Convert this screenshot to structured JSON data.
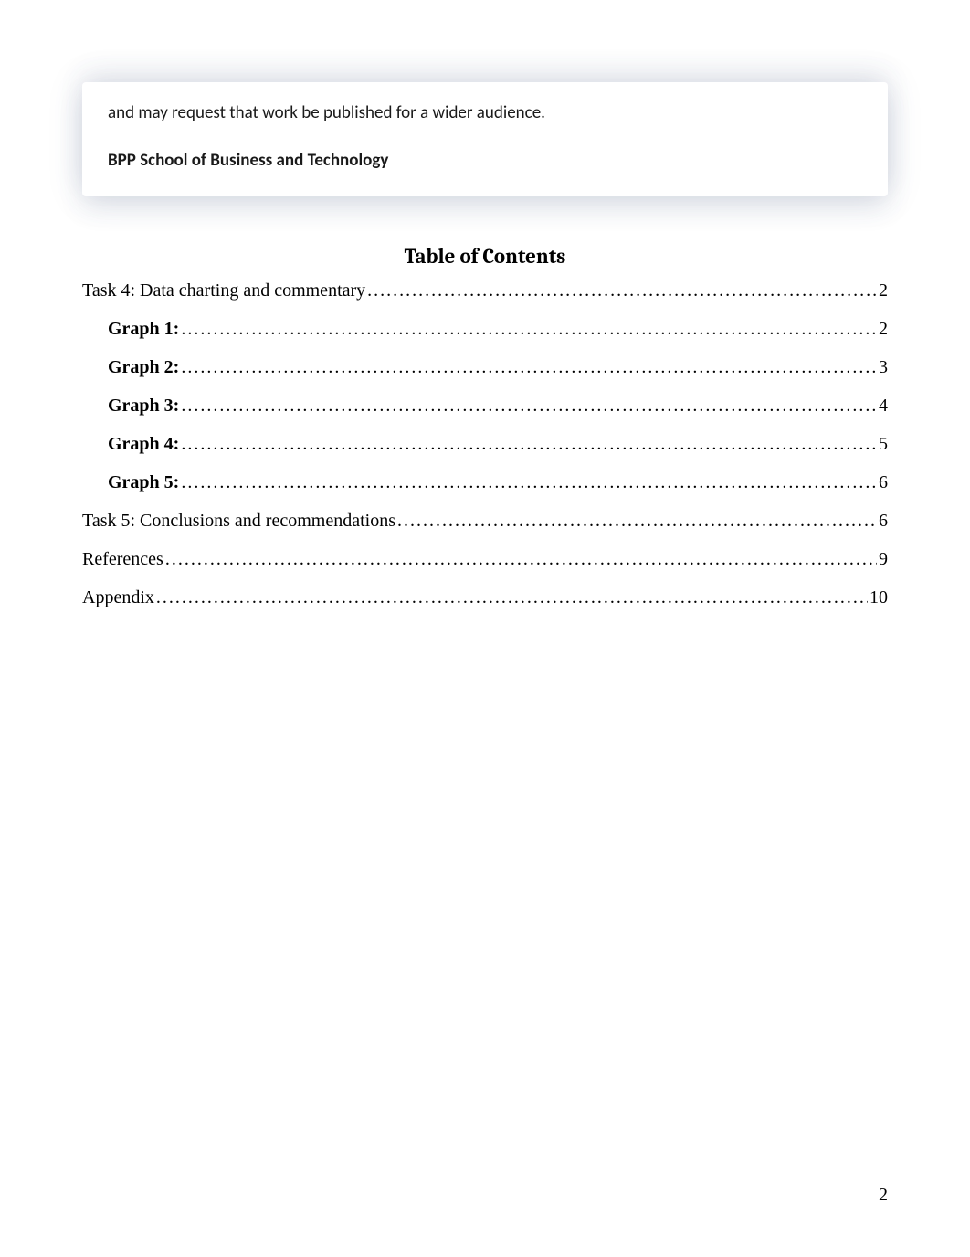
{
  "info_box": {
    "line": "and may request that work be published for a wider audience.",
    "school": "BPP School of Business and Technology"
  },
  "toc": {
    "heading": "Table of Contents",
    "entries": [
      {
        "label": "Task 4: Data charting and commentary",
        "page": "2",
        "level": 1,
        "bold": false
      },
      {
        "label": "Graph 1:",
        "page": "2",
        "level": 2,
        "bold": true
      },
      {
        "label": "Graph 2:",
        "page": "3",
        "level": 2,
        "bold": true
      },
      {
        "label": "Graph 3:",
        "page": "4",
        "level": 2,
        "bold": true
      },
      {
        "label": "Graph 4:",
        "page": "5",
        "level": 2,
        "bold": true
      },
      {
        "label": "Graph 5:",
        "page": "6",
        "level": 2,
        "bold": true
      },
      {
        "label": "Task 5: Conclusions and recommendations",
        "page": "6",
        "level": 1,
        "bold": false
      },
      {
        "label": "References",
        "page": "9",
        "level": 1,
        "bold": false
      },
      {
        "label": "Appendix",
        "page": "10",
        "level": 1,
        "bold": false
      }
    ]
  },
  "page_number": "2"
}
